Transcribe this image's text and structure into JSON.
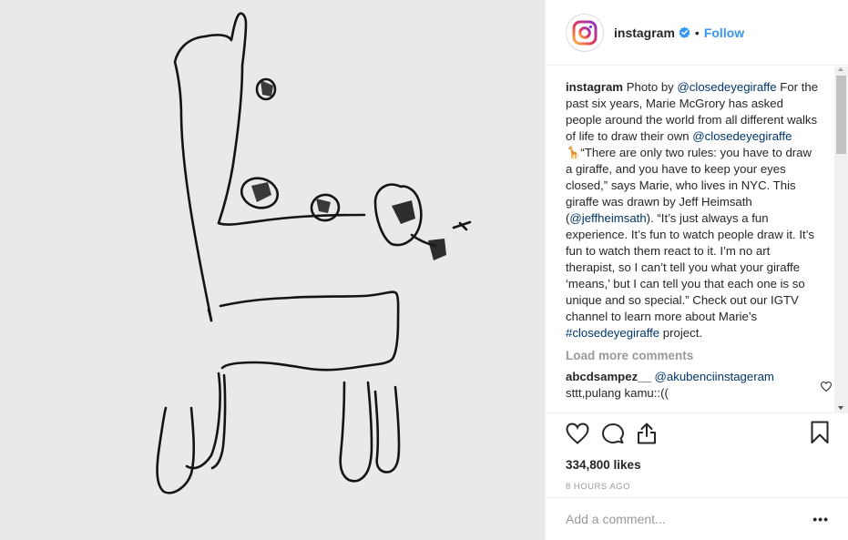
{
  "header": {
    "username": "instagram",
    "dot": "•",
    "follow_label": "Follow"
  },
  "caption": {
    "username": "instagram",
    "p1": " Photo by ",
    "mention1": "@closedeyegiraffe",
    "p2": " For the past six years, Marie McGrory has asked people around the world from all different walks of life to draw their own ",
    "mention2": "@closedeyegiraffe",
    "emoji": "🦒",
    "p3": "“There are only two rules: you have to draw a giraffe, and you have to keep your eyes closed,” says Marie, who lives in NYC. This giraffe was drawn by Jeff Heimsath (",
    "mention3": "@jeffheimsath",
    "p4": "). “It’s just always a fun experience. It’s fun to watch people draw it. It’s fun to watch them react to it. I’m no art therapist, so I can’t tell you what your giraffe ‘means,’ but I can tell you that each one is so unique and so special.” Check out our IGTV channel to learn more about Marie’s ",
    "hashtag": "#closedeyegiraffe",
    "p5": " project."
  },
  "load_more_label": "Load more comments",
  "comment": {
    "username": "abcdsampez__",
    "mention": "@akubenciinstageram",
    "text": "sttt,pulang kamu::(("
  },
  "likes": "334,800 likes",
  "time": "8 HOURS AGO",
  "add_comment": {
    "placeholder": "Add a comment...",
    "more_label": "•••"
  },
  "icons": {
    "logo": "instagram-logo-icon",
    "verified": "verified-badge-icon",
    "like": "heart-icon",
    "comment": "comment-bubble-icon",
    "share": "share-icon",
    "save": "bookmark-icon",
    "comment_like": "small-heart-icon"
  },
  "colors": {
    "accent": "#3897f0",
    "link": "#003569",
    "muted": "#999999",
    "verified": "#3897f0"
  }
}
